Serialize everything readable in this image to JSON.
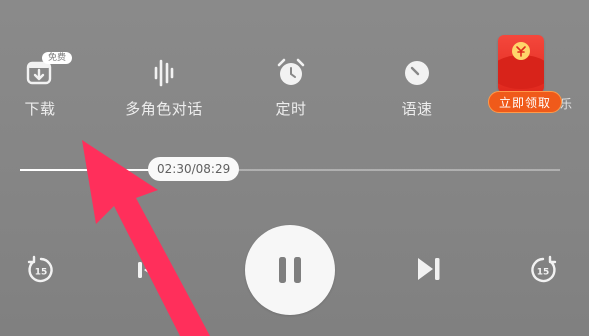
{
  "toolbar": {
    "download": {
      "label": "下载",
      "badge": "免费",
      "icon": "download-icon"
    },
    "multi_role": {
      "label": "多角色对话",
      "icon": "waveform-icon"
    },
    "timer": {
      "label": "定时",
      "icon": "alarm-clock-icon"
    },
    "speed": {
      "label": "语速",
      "icon": "speed-gauge-icon"
    }
  },
  "promo": {
    "button_label": "立即领取",
    "side_text": "音乐",
    "icon": "red-envelope-icon",
    "colors": {
      "envelope": "#e0281d",
      "button": "#f05a1a"
    }
  },
  "playback": {
    "time_display": "02:30/08:29",
    "progress_fraction": 0.295,
    "rewind_seconds": "15",
    "forward_seconds": "15",
    "state": "playing"
  },
  "overlay": {
    "annotation_arrow_color": "#ff2f5b"
  }
}
